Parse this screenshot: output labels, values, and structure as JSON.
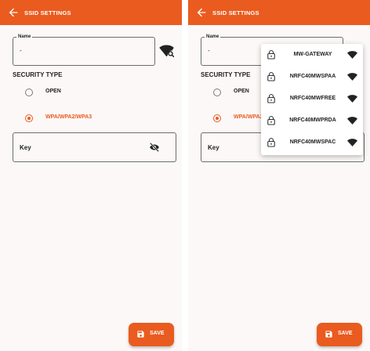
{
  "appbar": {
    "title": "SSID SETTINGS"
  },
  "name_field": {
    "label": "Name",
    "value": "-"
  },
  "security": {
    "title": "SECURITY TYPE",
    "options": [
      {
        "label": "OPEN",
        "selected": false
      },
      {
        "label": "WPA/WPA2/WPA3",
        "selected": true
      }
    ]
  },
  "key_field": {
    "label": "Key"
  },
  "save_button": {
    "label": "SAVE"
  },
  "ssid_dropdown": {
    "items": [
      {
        "label": "MW-GATEWAY"
      },
      {
        "label": "NRFC40MWSPAA"
      },
      {
        "label": "NRFC40MWFREE"
      },
      {
        "label": "NRFC40MWPRDA"
      },
      {
        "label": "NRFC40MWSPAC"
      }
    ]
  },
  "colors": {
    "accent": "#ea5b1f",
    "surface": "#fcf8f8"
  },
  "icons": [
    "back-arrow-icon",
    "wifi-search-icon",
    "eye-off-icon",
    "save-icon",
    "lock-icon",
    "wifi-signal-icon"
  ]
}
